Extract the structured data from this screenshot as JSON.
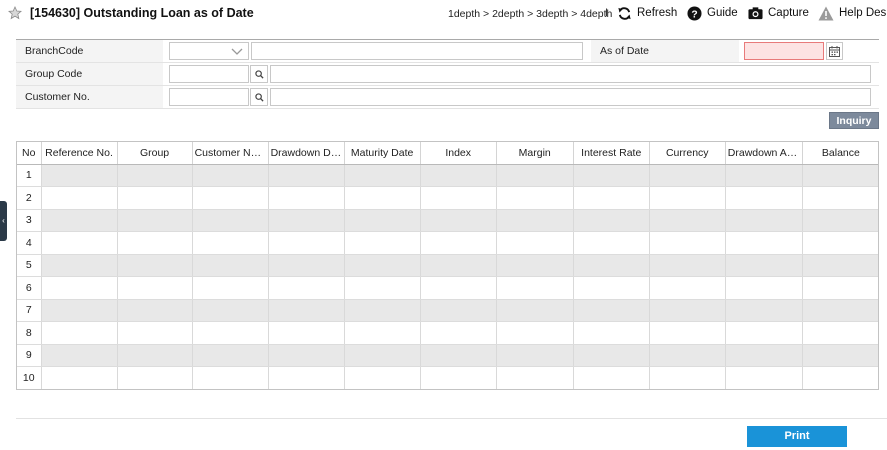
{
  "header": {
    "title": "[154630] Outstanding Loan as of Date",
    "breadcrumb": "1depth > 2depth > 3depth > 4depth",
    "separator": "I",
    "tools": {
      "refresh": "Refresh",
      "guide": "Guide",
      "capture": "Capture",
      "help_desk": "Help Desk"
    }
  },
  "form": {
    "branch_code_label": "BranchCode",
    "as_of_date_label": "As of Date",
    "group_code_label": "Group Code",
    "customer_no_label": "Customer No.",
    "branch_code_value": "",
    "branch_name_value": "",
    "as_of_date_value": "",
    "group_code_value": "",
    "group_name_value": "",
    "customer_no_value": "",
    "customer_name_value": ""
  },
  "buttons": {
    "inquiry": "Inquiry",
    "print": "Print"
  },
  "grid": {
    "columns": [
      "No",
      "Reference No.",
      "Group",
      "Customer Name",
      "Drawdown Date",
      "Maturity Date",
      "Index",
      "Margin",
      "Interest Rate",
      "Currency",
      "Drawdown Am…",
      "Balance"
    ],
    "row_numbers": [
      "1",
      "2",
      "3",
      "4",
      "5",
      "6",
      "7",
      "8",
      "9",
      "10"
    ]
  },
  "side_tab": {
    "glyph": "‹"
  },
  "colors": {
    "print_button": "#1a93d8",
    "inquiry_button": "#7d8a9c",
    "required_field": "#fde3e3",
    "side_tab": "#2b3a48"
  }
}
